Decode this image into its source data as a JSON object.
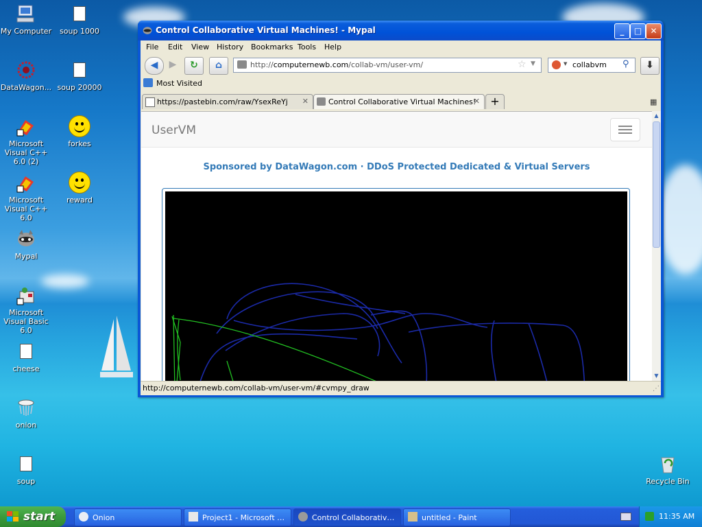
{
  "desktop": {
    "icons": [
      {
        "label": "My Computer",
        "icon": "computer-icon"
      },
      {
        "label": "soup 1000",
        "icon": "file-icon"
      },
      {
        "label": "DataWagon...",
        "icon": "datawagon-icon"
      },
      {
        "label": "soup 20000",
        "icon": "file-icon"
      },
      {
        "label": "Microsoft Visual C++ 6.0 (2)",
        "icon": "visual-cpp-icon"
      },
      {
        "label": "forkes",
        "icon": "smiley-icon"
      },
      {
        "label": "Microsoft Visual C++ 6.0",
        "icon": "visual-cpp-icon"
      },
      {
        "label": "reward",
        "icon": "smiley-icon"
      },
      {
        "label": "Mypal",
        "icon": "raccoon-icon"
      },
      {
        "label": "Microsoft Visual Basic 6.0",
        "icon": "visual-basic-icon"
      },
      {
        "label": "cheese",
        "icon": "file-icon"
      },
      {
        "label": "onion",
        "icon": "onion-icon"
      },
      {
        "label": "soup",
        "icon": "file-icon"
      },
      {
        "label": "Recycle Bin",
        "icon": "recycle-bin-icon"
      }
    ]
  },
  "window": {
    "title": "Control Collaborative Virtual Machines! - Mypal",
    "menu": [
      "File",
      "Edit",
      "View",
      "History",
      "Bookmarks",
      "Tools",
      "Help"
    ],
    "url_scheme": "http://",
    "url_host": "computernewb.com",
    "url_path": "/collab-vm/user-vm/",
    "search_value": "collabvm",
    "bookmark_label": "Most Visited",
    "tabs": [
      {
        "label": "https://pastebin.com/raw/YsexReYj",
        "active": false
      },
      {
        "label": "Control Collaborative Virtual Machines!",
        "active": true
      }
    ],
    "status_text": "http://computernewb.com/collab-vm/user-vm/#cvmpy_draw"
  },
  "page": {
    "brand": "UserVM",
    "sponsor": "Sponsored by DataWagon.com · DDoS Protected Dedicated & Virtual Servers"
  },
  "taskbar": {
    "start_label": "start",
    "tasks": [
      {
        "label": "Onion",
        "active": false
      },
      {
        "label": "Project1 - Microsoft V...",
        "active": false
      },
      {
        "label": "Control Collaborative ...",
        "active": true
      },
      {
        "label": "untitled - Paint",
        "active": false
      }
    ],
    "clock": "11:35 AM"
  },
  "colors": {
    "xp_blue": "#0a57d6",
    "link_blue": "#337ab7",
    "start_green": "#3c9a3c",
    "drawing_blue": "#1b2aa8",
    "drawing_green": "#22c022"
  }
}
